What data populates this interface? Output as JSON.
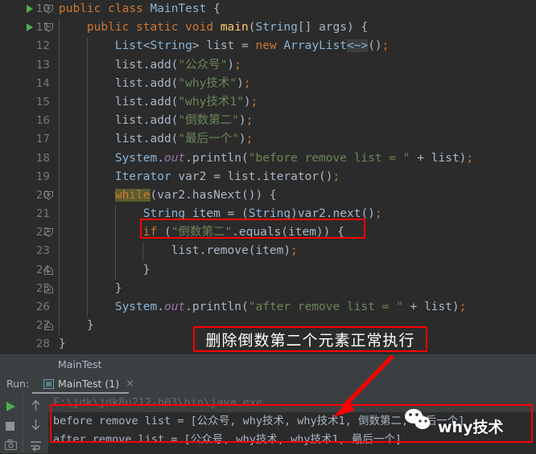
{
  "editor": {
    "lines": [
      {
        "num": "10",
        "run": true,
        "fold": "open",
        "indent": 0,
        "html": "<span class=\"kw\">public</span> <span class=\"kw\">class</span> <span class=\"typ\">MainTest</span> <span class=\"pun\">{</span>"
      },
      {
        "num": "11",
        "run": true,
        "fold": "open",
        "indent": 1,
        "html": "    <span class=\"kw\">public</span> <span class=\"kw\">static</span> <span class=\"kw\">void</span> <span class=\"mtd\">main</span><span class=\"pun\">(</span><span class=\"typ\">String</span><span class=\"pun\">[] args) {</span>"
      },
      {
        "num": "12",
        "run": false,
        "fold": "none",
        "indent": 2,
        "html": "        <span class=\"typ\">List</span><span class=\"pun\">&lt;</span><span class=\"typ\">String</span><span class=\"pun\">&gt;</span> <span class=\"plain\">list</span> <span class=\"pun\">=</span> <span class=\"kw\">new</span> <span class=\"typ\">ArrayList</span><span class=\"fold-chunk\">&lt;~&gt;</span><span class=\"pun\">()</span><span class=\"semi\">;</span>"
      },
      {
        "num": "13",
        "run": false,
        "fold": "none",
        "indent": 2,
        "html": "        <span class=\"plain\">list.add(</span><span class=\"str\">\"公众号\"</span><span class=\"plain\">)</span><span class=\"semi\">;</span>"
      },
      {
        "num": "14",
        "run": false,
        "fold": "none",
        "indent": 2,
        "html": "        <span class=\"plain\">list.add(</span><span class=\"str\">\"why技术\"</span><span class=\"plain\">)</span><span class=\"semi\">;</span>"
      },
      {
        "num": "15",
        "run": false,
        "fold": "none",
        "indent": 2,
        "html": "        <span class=\"plain\">list.add(</span><span class=\"str\">\"why技术1\"</span><span class=\"plain\">)</span><span class=\"semi\">;</span>"
      },
      {
        "num": "16",
        "run": false,
        "fold": "none",
        "indent": 2,
        "html": "        <span class=\"plain\">list.add(</span><span class=\"str\">\"倒数第二\"</span><span class=\"plain\">)</span><span class=\"semi\">;</span>"
      },
      {
        "num": "17",
        "run": false,
        "fold": "none",
        "indent": 2,
        "html": "        <span class=\"plain\">list.add(</span><span class=\"str\">\"最后一个\"</span><span class=\"plain\">)</span><span class=\"semi\">;</span>"
      },
      {
        "num": "18",
        "run": false,
        "fold": "none",
        "indent": 2,
        "html": "        <span class=\"typ\">System</span><span class=\"plain\">.</span><span class=\"fld\">out</span><span class=\"plain\">.println(</span><span class=\"str\">\"before remove list = \"</span> <span class=\"pun\">+</span> <span class=\"plain\">list)</span><span class=\"semi\">;</span>"
      },
      {
        "num": "19",
        "run": false,
        "fold": "none",
        "indent": 2,
        "html": "        <span class=\"typ\">Iterator</span> <span class=\"plain\">var2</span> <span class=\"pun\">=</span> <span class=\"plain\">list.iterator()</span><span class=\"semi\">;</span>"
      },
      {
        "num": "20",
        "run": false,
        "fold": "open",
        "indent": 2,
        "html": "        <span class=\"hl-while\">while</span><span class=\"plain\">(var2.hasNext()) {</span>"
      },
      {
        "num": "21",
        "run": false,
        "fold": "none",
        "indent": 3,
        "html": "            <span class=\"typ\">String</span> <span class=\"plain\">item</span> <span class=\"pun\">=</span> <span class=\"plain\">(</span><span class=\"typ\">String</span><span class=\"plain\">)var2.next()</span><span class=\"semi\">;</span>"
      },
      {
        "num": "22",
        "run": false,
        "fold": "open",
        "indent": 3,
        "html": "            <span class=\"kw\">if</span> <span class=\"plain\">(</span><span class=\"str\">\"倒数第二\"</span><span class=\"plain\">.equals(item)) {</span>"
      },
      {
        "num": "23",
        "run": false,
        "fold": "none",
        "indent": 4,
        "html": "                <span class=\"plain\">list.remove(item)</span><span class=\"semi\">;</span>"
      },
      {
        "num": "24",
        "run": false,
        "fold": "closed",
        "indent": 3,
        "html": "            <span class=\"pun\">}</span>"
      },
      {
        "num": "25",
        "run": false,
        "fold": "closed",
        "indent": 2,
        "html": "        <span class=\"pun\">}</span>"
      },
      {
        "num": "26",
        "run": false,
        "fold": "none",
        "indent": 2,
        "html": "        <span class=\"typ\">System</span><span class=\"plain\">.</span><span class=\"fld\">out</span><span class=\"plain\">.println(</span><span class=\"str\">\"after remove list = \"</span> <span class=\"pun\">+</span> <span class=\"plain\">list)</span><span class=\"semi\">;</span>"
      },
      {
        "num": "27",
        "run": false,
        "fold": "closed",
        "indent": 1,
        "html": "    <span class=\"pun\">}</span>"
      },
      {
        "num": "28",
        "run": false,
        "fold": "none",
        "indent": 0,
        "html": "<span class=\"pun\">}</span>"
      }
    ]
  },
  "breadcrumb": {
    "path": "MainTest"
  },
  "run_panel": {
    "run_label": "Run:",
    "tab_label": "MainTest (1)",
    "tab_close": "×",
    "toolbar": {
      "run_icon": "play-icon",
      "stop_icon": "stop-icon",
      "camera_icon": "camera-icon",
      "up_icon": "arrow-up-icon",
      "down_icon": "arrow-down-icon",
      "wrap_icon": "soft-wrap-icon"
    },
    "console": {
      "command": "E:\\jdk\\jdk8u212-b03\\bin\\java.exe ...",
      "line1": "before remove list = [公众号, why技术, why技术1, 倒数第二, 最后一个]",
      "line2": "after remove list = [公众号, why技术, why技术1, 最后一个]"
    }
  },
  "annotations": {
    "box_text": "删除倒数第二个元素正常执行",
    "accent_color": "#ff0000"
  },
  "watermark": {
    "text": "why技术",
    "icon": "wechat-icon"
  }
}
